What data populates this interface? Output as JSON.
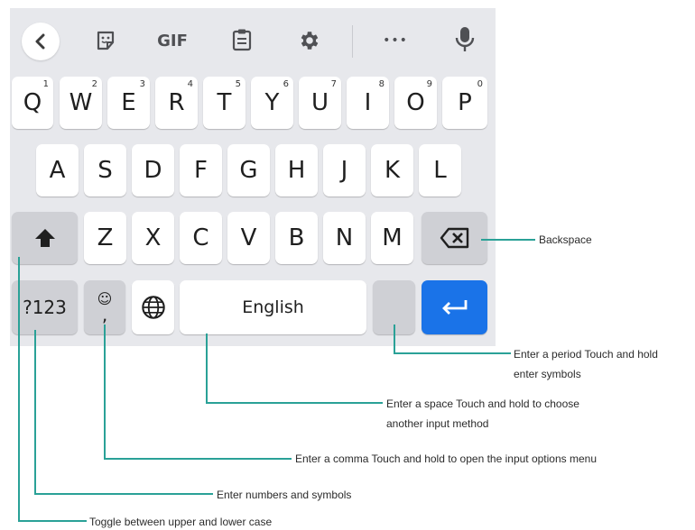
{
  "toolbar": {
    "icons": [
      "back-chevron-icon",
      "sticker-icon",
      "gif",
      "clipboard-icon",
      "gear-icon",
      "more-icon",
      "microphone-icon"
    ],
    "gif_label": "GIF",
    "more_label": "•••"
  },
  "rows": {
    "row1": [
      {
        "key": "Q",
        "hint": "1"
      },
      {
        "key": "W",
        "hint": "2"
      },
      {
        "key": "E",
        "hint": "3"
      },
      {
        "key": "R",
        "hint": "4"
      },
      {
        "key": "T",
        "hint": "5"
      },
      {
        "key": "Y",
        "hint": "6"
      },
      {
        "key": "U",
        "hint": "7"
      },
      {
        "key": "I",
        "hint": "8"
      },
      {
        "key": "O",
        "hint": "9"
      },
      {
        "key": "P",
        "hint": "0"
      }
    ],
    "row2": [
      "A",
      "S",
      "D",
      "F",
      "G",
      "H",
      "J",
      "K",
      "L"
    ],
    "row3": [
      "Z",
      "X",
      "C",
      "V",
      "B",
      "N",
      "M"
    ]
  },
  "bottom": {
    "symbols": "?123",
    "emoji": "☺",
    "comma": ",",
    "space": "English"
  },
  "annotations": {
    "backspace": "Backspace",
    "period_line1": "Enter a period Touch and hold",
    "period_line2": "enter symbols",
    "space_line1": "Enter a space Touch and hold to choose",
    "space_line2": "another input method",
    "comma": "Enter a comma Touch and hold to open the input options menu",
    "numbers": "Enter numbers and symbols",
    "shift": "Toggle between upper and lower case"
  },
  "colors": {
    "keyboard_bg": "#e7e8ec",
    "key_bg": "#ffffff",
    "mod_key_bg": "#cfd0d5",
    "enter_key_bg": "#1a73e8",
    "annotation_line": "#2aa197"
  }
}
